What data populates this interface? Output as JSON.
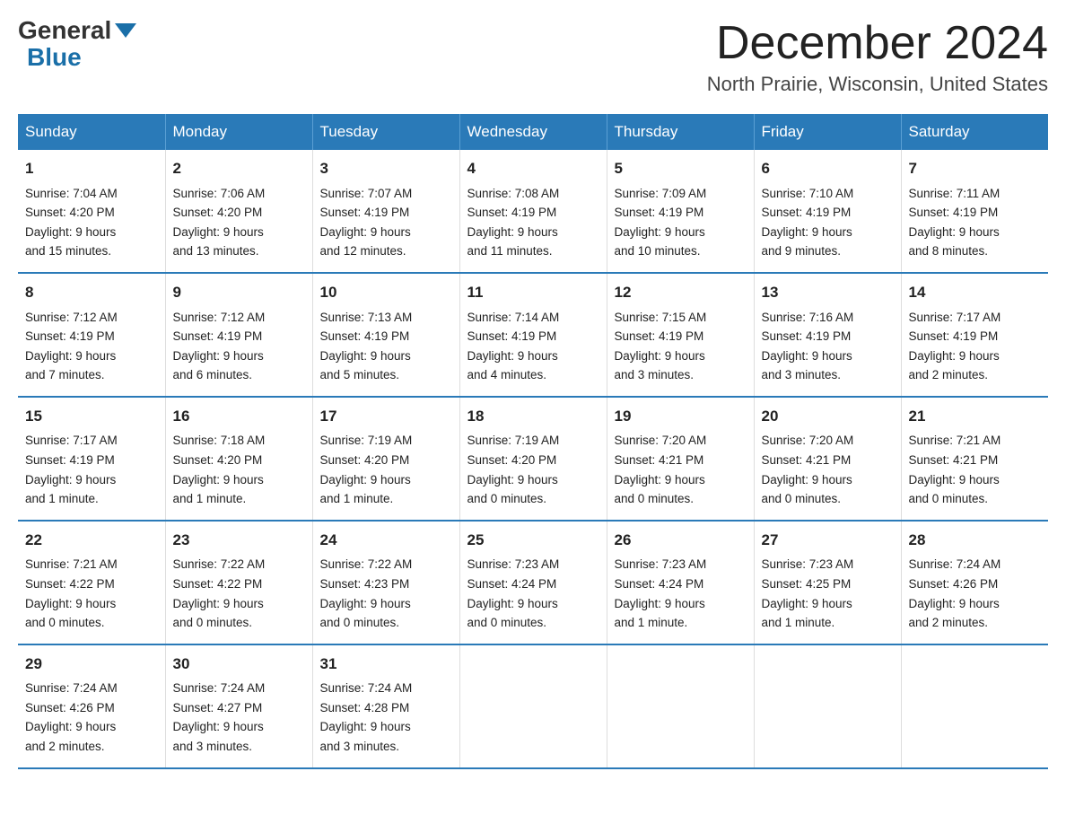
{
  "header": {
    "logo_general": "General",
    "logo_blue": "Blue",
    "month_title": "December 2024",
    "location": "North Prairie, Wisconsin, United States"
  },
  "weekdays": [
    "Sunday",
    "Monday",
    "Tuesday",
    "Wednesday",
    "Thursday",
    "Friday",
    "Saturday"
  ],
  "weeks": [
    [
      {
        "day": "1",
        "sunrise": "7:04 AM",
        "sunset": "4:20 PM",
        "daylight": "9 hours and 15 minutes."
      },
      {
        "day": "2",
        "sunrise": "7:06 AM",
        "sunset": "4:20 PM",
        "daylight": "9 hours and 13 minutes."
      },
      {
        "day": "3",
        "sunrise": "7:07 AM",
        "sunset": "4:19 PM",
        "daylight": "9 hours and 12 minutes."
      },
      {
        "day": "4",
        "sunrise": "7:08 AM",
        "sunset": "4:19 PM",
        "daylight": "9 hours and 11 minutes."
      },
      {
        "day": "5",
        "sunrise": "7:09 AM",
        "sunset": "4:19 PM",
        "daylight": "9 hours and 10 minutes."
      },
      {
        "day": "6",
        "sunrise": "7:10 AM",
        "sunset": "4:19 PM",
        "daylight": "9 hours and 9 minutes."
      },
      {
        "day": "7",
        "sunrise": "7:11 AM",
        "sunset": "4:19 PM",
        "daylight": "9 hours and 8 minutes."
      }
    ],
    [
      {
        "day": "8",
        "sunrise": "7:12 AM",
        "sunset": "4:19 PM",
        "daylight": "9 hours and 7 minutes."
      },
      {
        "day": "9",
        "sunrise": "7:12 AM",
        "sunset": "4:19 PM",
        "daylight": "9 hours and 6 minutes."
      },
      {
        "day": "10",
        "sunrise": "7:13 AM",
        "sunset": "4:19 PM",
        "daylight": "9 hours and 5 minutes."
      },
      {
        "day": "11",
        "sunrise": "7:14 AM",
        "sunset": "4:19 PM",
        "daylight": "9 hours and 4 minutes."
      },
      {
        "day": "12",
        "sunrise": "7:15 AM",
        "sunset": "4:19 PM",
        "daylight": "9 hours and 3 minutes."
      },
      {
        "day": "13",
        "sunrise": "7:16 AM",
        "sunset": "4:19 PM",
        "daylight": "9 hours and 3 minutes."
      },
      {
        "day": "14",
        "sunrise": "7:17 AM",
        "sunset": "4:19 PM",
        "daylight": "9 hours and 2 minutes."
      }
    ],
    [
      {
        "day": "15",
        "sunrise": "7:17 AM",
        "sunset": "4:19 PM",
        "daylight": "9 hours and 1 minute."
      },
      {
        "day": "16",
        "sunrise": "7:18 AM",
        "sunset": "4:20 PM",
        "daylight": "9 hours and 1 minute."
      },
      {
        "day": "17",
        "sunrise": "7:19 AM",
        "sunset": "4:20 PM",
        "daylight": "9 hours and 1 minute."
      },
      {
        "day": "18",
        "sunrise": "7:19 AM",
        "sunset": "4:20 PM",
        "daylight": "9 hours and 0 minutes."
      },
      {
        "day": "19",
        "sunrise": "7:20 AM",
        "sunset": "4:21 PM",
        "daylight": "9 hours and 0 minutes."
      },
      {
        "day": "20",
        "sunrise": "7:20 AM",
        "sunset": "4:21 PM",
        "daylight": "9 hours and 0 minutes."
      },
      {
        "day": "21",
        "sunrise": "7:21 AM",
        "sunset": "4:21 PM",
        "daylight": "9 hours and 0 minutes."
      }
    ],
    [
      {
        "day": "22",
        "sunrise": "7:21 AM",
        "sunset": "4:22 PM",
        "daylight": "9 hours and 0 minutes."
      },
      {
        "day": "23",
        "sunrise": "7:22 AM",
        "sunset": "4:22 PM",
        "daylight": "9 hours and 0 minutes."
      },
      {
        "day": "24",
        "sunrise": "7:22 AM",
        "sunset": "4:23 PM",
        "daylight": "9 hours and 0 minutes."
      },
      {
        "day": "25",
        "sunrise": "7:23 AM",
        "sunset": "4:24 PM",
        "daylight": "9 hours and 0 minutes."
      },
      {
        "day": "26",
        "sunrise": "7:23 AM",
        "sunset": "4:24 PM",
        "daylight": "9 hours and 1 minute."
      },
      {
        "day": "27",
        "sunrise": "7:23 AM",
        "sunset": "4:25 PM",
        "daylight": "9 hours and 1 minute."
      },
      {
        "day": "28",
        "sunrise": "7:24 AM",
        "sunset": "4:26 PM",
        "daylight": "9 hours and 2 minutes."
      }
    ],
    [
      {
        "day": "29",
        "sunrise": "7:24 AM",
        "sunset": "4:26 PM",
        "daylight": "9 hours and 2 minutes."
      },
      {
        "day": "30",
        "sunrise": "7:24 AM",
        "sunset": "4:27 PM",
        "daylight": "9 hours and 3 minutes."
      },
      {
        "day": "31",
        "sunrise": "7:24 AM",
        "sunset": "4:28 PM",
        "daylight": "9 hours and 3 minutes."
      },
      null,
      null,
      null,
      null
    ]
  ],
  "labels": {
    "sunrise": "Sunrise:",
    "sunset": "Sunset:",
    "daylight": "Daylight:"
  }
}
